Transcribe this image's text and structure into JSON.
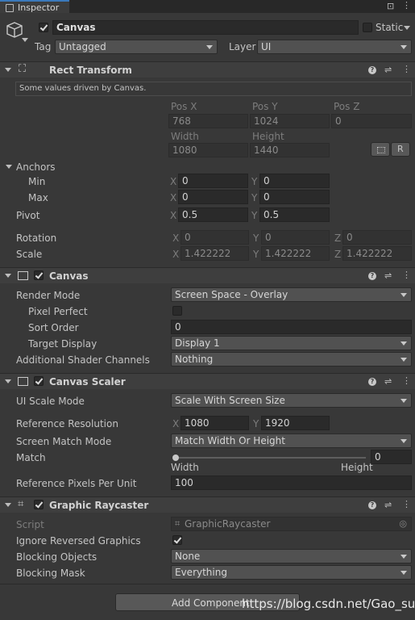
{
  "tab": {
    "title": "Inspector"
  },
  "object": {
    "active": true,
    "name": "Canvas",
    "static_label": "Static",
    "tag_label": "Tag",
    "tag_value": "Untagged",
    "layer_label": "Layer",
    "layer_value": "UI"
  },
  "rect_transform": {
    "title": "Rect Transform",
    "note": "Some values driven by Canvas.",
    "pos_x_label": "Pos X",
    "pos_y_label": "Pos Y",
    "pos_z_label": "Pos Z",
    "pos_x": "768",
    "pos_y": "1024",
    "pos_z": "0",
    "width_label": "Width",
    "height_label": "Height",
    "width": "1080",
    "height": "1440",
    "r_label": "R",
    "anchors_label": "Anchors",
    "min_label": "Min",
    "max_label": "Max",
    "min_x": "0",
    "min_y": "0",
    "max_x": "0",
    "max_y": "0",
    "pivot_label": "Pivot",
    "pivot_x": "0.5",
    "pivot_y": "0.5",
    "rotation_label": "Rotation",
    "rot_x": "0",
    "rot_y": "0",
    "rot_z": "0",
    "scale_label": "Scale",
    "scale_x": "1.422222",
    "scale_y": "1.422222",
    "scale_z": "1.422222",
    "x": "X",
    "y": "Y",
    "z": "Z"
  },
  "canvas": {
    "title": "Canvas",
    "enabled": true,
    "render_mode_label": "Render Mode",
    "render_mode": "Screen Space - Overlay",
    "pixel_perfect_label": "Pixel Perfect",
    "pixel_perfect": false,
    "sort_order_label": "Sort Order",
    "sort_order": "0",
    "target_display_label": "Target Display",
    "target_display": "Display 1",
    "shader_channels_label": "Additional Shader Channels",
    "shader_channels": "Nothing"
  },
  "canvas_scaler": {
    "title": "Canvas Scaler",
    "enabled": true,
    "ui_scale_mode_label": "UI Scale Mode",
    "ui_scale_mode": "Scale With Screen Size",
    "ref_res_label": "Reference Resolution",
    "ref_x": "1080",
    "ref_y": "1920",
    "match_mode_label": "Screen Match Mode",
    "match_mode": "Match Width Or Height",
    "match_label": "Match",
    "match_value": "0",
    "match_fraction": 0,
    "width_label": "Width",
    "height_label": "Height",
    "ref_ppu_label": "Reference Pixels Per Unit",
    "ref_ppu": "100"
  },
  "graphic_raycaster": {
    "title": "Graphic Raycaster",
    "enabled": true,
    "script_label": "Script",
    "script_value": "GraphicRaycaster",
    "ignore_reversed_label": "Ignore Reversed Graphics",
    "ignore_reversed": true,
    "blocking_objects_label": "Blocking Objects",
    "blocking_objects": "None",
    "blocking_mask_label": "Blocking Mask",
    "blocking_mask": "Everything"
  },
  "add_component": {
    "label": "Add Component"
  },
  "watermark": "https://blog.csdn.net/Gao_sun"
}
